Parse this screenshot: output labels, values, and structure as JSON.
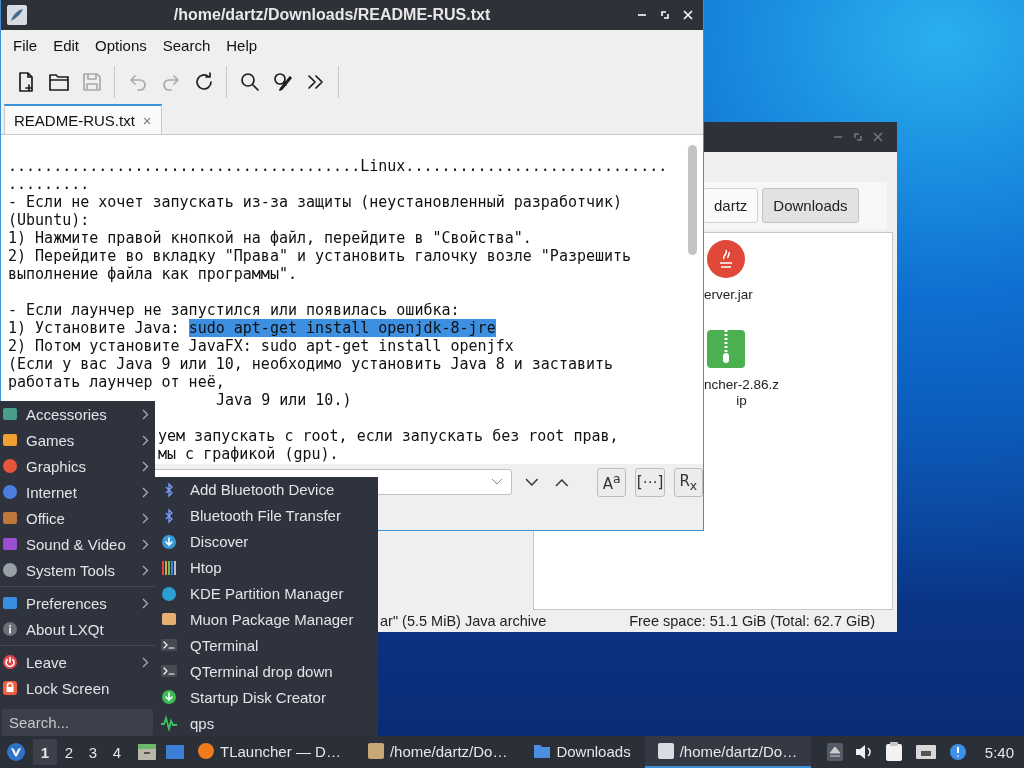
{
  "file_manager": {
    "path_buttons": [
      {
        "label": "dartz",
        "selected": false
      },
      {
        "label": "Downloads",
        "selected": true
      }
    ],
    "files": [
      {
        "kind": "jar",
        "name_lines": [
          "erver.jar"
        ]
      },
      {
        "kind": "zip",
        "name_lines": [
          "ncher-2.86.z",
          "ip"
        ]
      }
    ],
    "status_left": "ar\" (5.5 MiB) Java archive",
    "status_right": "Free space: 51.1 GiB (Total: 62.7 GiB)"
  },
  "editor": {
    "title": "/home/dartz/Downloads/README-RUS.txt",
    "menu": [
      "File",
      "Edit",
      "Options",
      "Search",
      "Help"
    ],
    "toolbar": [
      {
        "kind": "new",
        "disabled": false
      },
      {
        "kind": "open",
        "disabled": false
      },
      {
        "kind": "save",
        "disabled": true
      },
      {
        "kind": "separator"
      },
      {
        "kind": "undo",
        "disabled": true
      },
      {
        "kind": "redo",
        "disabled": true
      },
      {
        "kind": "reload",
        "disabled": false
      },
      {
        "kind": "separator"
      },
      {
        "kind": "find",
        "disabled": false
      },
      {
        "kind": "replace",
        "disabled": false
      },
      {
        "kind": "more",
        "disabled": false
      },
      {
        "kind": "separator"
      }
    ],
    "tabs": [
      {
        "label": "README-RUS.txt",
        "selected": true,
        "close": "×"
      }
    ],
    "lines": [
      {
        "kind": "text",
        "text": ".......................................Linux............................."
      },
      {
        "kind": "text",
        "text": "........."
      },
      {
        "kind": "text",
        "text": "- Если не хочет запускать из-за защиты (неустановленный разработчик)"
      },
      {
        "kind": "text",
        "text": "(Ubuntu):"
      },
      {
        "kind": "text",
        "text": "1) Нажмите правой кнопкой на файл, перейдите в \"Свойства\"."
      },
      {
        "kind": "text",
        "text": "2) Перейдите во вкладку \"Права\" и установить галочку возле \"Разрешить"
      },
      {
        "kind": "text",
        "text": "выполнение файла как программы\"."
      },
      {
        "kind": "blank"
      },
      {
        "kind": "text",
        "text": "- Если лаунчер не запустился или появилась ошибка:"
      },
      {
        "kind": "text",
        "text": "1) Установите Java: ",
        "selection": "sudo apt-get install openjdk-8-jre"
      },
      {
        "kind": "text",
        "text": "2) Потом установите JavaFX: sudo apt-get install openjfx"
      },
      {
        "kind": "text",
        "text": "(Если у вас Java 9 или 10, необходимо установить Java 8 и заставить"
      },
      {
        "kind": "text",
        "text": "работать лаунчер от неё,"
      },
      {
        "kind": "tail",
        "text": "Java 9 или 10.)"
      },
      {
        "kind": "blank"
      },
      {
        "kind": "partial",
        "text": "уем запускать с root, если запускать без root прав,"
      },
      {
        "kind": "partial",
        "text": "мы с графикой (gpu)."
      }
    ],
    "find_buttons": [
      "A$^{a}$",
      "[⋯]",
      "R$_{x}$"
    ]
  },
  "start_menu": {
    "items": [
      {
        "kind": "item",
        "label": "Accessories",
        "submenu": true,
        "expanded": false
      },
      {
        "kind": "item",
        "label": "Games",
        "submenu": true,
        "expanded": false
      },
      {
        "kind": "item",
        "label": "Graphics",
        "submenu": true,
        "expanded": false
      },
      {
        "kind": "item",
        "label": "Internet",
        "submenu": true,
        "expanded": false
      },
      {
        "kind": "item",
        "label": "Office",
        "submenu": true,
        "expanded": false
      },
      {
        "kind": "item",
        "label": "Sound & Video",
        "submenu": true,
        "expanded": false
      },
      {
        "kind": "item",
        "label": "System Tools",
        "submenu": true,
        "expanded": true,
        "children": [
          "Add Bluetooth Device",
          "Bluetooth File Transfer",
          "Discover",
          "Htop",
          "KDE Partition Manager",
          "Muon Package Manager",
          "QTerminal",
          "QTerminal drop down",
          "Startup Disk Creator",
          "qps"
        ]
      },
      {
        "kind": "separator"
      },
      {
        "kind": "item",
        "label": "Preferences",
        "submenu": true,
        "expanded": false
      },
      {
        "kind": "item",
        "label": "About LXQt",
        "submenu": false
      },
      {
        "kind": "separator"
      },
      {
        "kind": "item",
        "label": "Leave",
        "submenu": true,
        "expanded": false
      },
      {
        "kind": "item",
        "label": "Lock Screen",
        "submenu": false
      }
    ],
    "search": {
      "placeholder": "Search..."
    }
  },
  "taskbar": {
    "workspaces": [
      {
        "label": "1",
        "selected": true
      },
      {
        "label": "2",
        "selected": false
      },
      {
        "label": "3",
        "selected": false
      },
      {
        "label": "4",
        "selected": false
      }
    ],
    "tasks": [
      {
        "label": "TLauncher — D…",
        "active": false
      },
      {
        "label": "/home/dartz/Do…",
        "active": false
      },
      {
        "label": "Downloads",
        "active": false
      },
      {
        "label": "/home/dartz/Do…",
        "active": true
      }
    ],
    "clock": "5:40"
  }
}
